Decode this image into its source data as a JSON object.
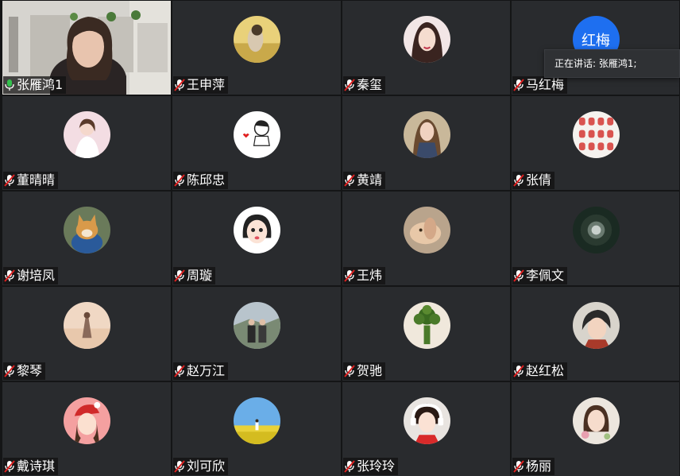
{
  "participants": [
    {
      "name": "张雁鸿1",
      "mic": "active",
      "video": true
    },
    {
      "name": "王申萍",
      "mic": "muted",
      "avatar": "photo"
    },
    {
      "name": "秦玺",
      "mic": "muted",
      "avatar": "photo"
    },
    {
      "name": "马红梅",
      "mic": "muted",
      "avatar": "text",
      "avatar_text": "红梅"
    },
    {
      "name": "董晴晴",
      "mic": "muted",
      "avatar": "photo"
    },
    {
      "name": "陈邱忠",
      "mic": "muted",
      "avatar": "photo"
    },
    {
      "name": "黄靖",
      "mic": "muted",
      "avatar": "photo"
    },
    {
      "name": "张倩",
      "mic": "muted",
      "avatar": "photo"
    },
    {
      "name": "谢培凤",
      "mic": "muted",
      "avatar": "photo"
    },
    {
      "name": "周璇",
      "mic": "muted",
      "avatar": "photo"
    },
    {
      "name": "王炜",
      "mic": "muted",
      "avatar": "photo"
    },
    {
      "name": "李佩文",
      "mic": "muted",
      "avatar": "photo"
    },
    {
      "name": "黎琴",
      "mic": "muted",
      "avatar": "photo"
    },
    {
      "name": "赵万江",
      "mic": "muted",
      "avatar": "photo"
    },
    {
      "name": "贺驰",
      "mic": "muted",
      "avatar": "photo"
    },
    {
      "name": "赵红松",
      "mic": "muted",
      "avatar": "photo"
    },
    {
      "name": "戴诗琪",
      "mic": "muted",
      "avatar": "photo"
    },
    {
      "name": "刘可欣",
      "mic": "muted",
      "avatar": "photo"
    },
    {
      "name": "张玲玲",
      "mic": "muted",
      "avatar": "photo"
    },
    {
      "name": "杨丽",
      "mic": "muted",
      "avatar": "photo"
    }
  ],
  "speaking_tooltip": "正在讲话: 张雁鸿1;",
  "colors": {
    "tile_bg": "#292b2e",
    "grid_bg": "#141516",
    "mic_active": "#33c24d",
    "mic_muted": "#e02020",
    "text_avatar_bg": "#1e6ff0"
  }
}
